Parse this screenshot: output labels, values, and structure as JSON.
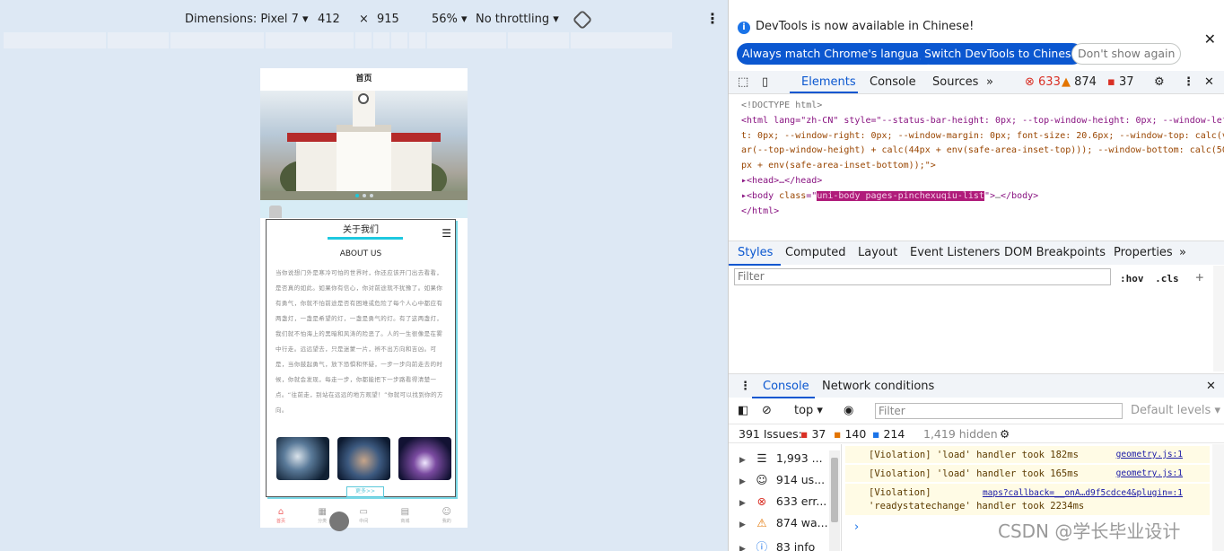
{
  "device_toolbar": {
    "dimensions": "Dimensions: Pixel 7 ▾",
    "width": "412",
    "times": "×",
    "height": "915",
    "zoom": "56% ▾",
    "throttling": "No throttling ▾"
  },
  "phone": {
    "title": "首页",
    "about_title": "关于我们",
    "about_sub": "ABOUT US",
    "about_text": "当你说想门外是寒冷可怕的世界时，你还应该开门出去看看，是否真的如此。如果你有信心，你对前途就不犹豫了。如果你有勇气，你就不怕前途是否有困难或危险了每个人心中都应有两盏灯，一盏是希望的灯，一盏是勇气的灯。有了这两盏灯，我们就不怕海上的黑暗和风涛的险恶了。人的一生很像是在雾中行走。远远望去，只是迷蒙一片，辨不出方向和吉凶。可是，当你鼓起勇气，放下恐惧和怀疑，一步一步向前走去的时候，你就会发现，每走一步，你都能把下一步路看得清楚一点。“往前走，别站在远远的地方观望！”你就可以找到你的方向。",
    "more_btn": "更多>>",
    "tabs": [
      "首页",
      "分类",
      "中间",
      "商城",
      "我的"
    ]
  },
  "devtools": {
    "banner_msg": "DevTools is now available in Chinese!",
    "btn_match": "Always match Chrome's language",
    "btn_switch": "Switch DevTools to Chinese",
    "btn_dont": "Don't show again",
    "tabs": {
      "elements": "Elements",
      "console": "Console",
      "sources": "Sources",
      "more": "»"
    },
    "counts": {
      "errors": "633",
      "warnings": "874",
      "issues": "37"
    },
    "dom": {
      "doctype": "<!DOCTYPE html>",
      "html_open_1": "<html lang=\"zh-CN\" style=\"--status-bar-height: 0px; --top-window-height: 0px; --window-lef",
      "html_open_2": "t: 0px; --window-right: 0px; --window-margin: 0px; font-size: 20.6px; --window-top: calc(v",
      "html_open_3": "ar(--top-window-height) + calc(44px + env(safe-area-inset-top))); --window-bottom: calc(50",
      "html_open_4": "px + env(safe-area-inset-bottom));\">",
      "head": "<head>…</head>",
      "body_class": "uni-body pages-pinchexuqiu-list",
      "html_close": "</html>"
    },
    "style_tabs": [
      "Styles",
      "Computed",
      "Layout",
      "Event Listeners",
      "DOM Breakpoints",
      "Properties",
      "»"
    ],
    "filter_placeholder": "Filter",
    "hov": ":hov",
    "cls": ".cls",
    "plus": "+",
    "console_tabs": [
      "Console",
      "Network conditions"
    ],
    "console_tools": {
      "context": "top ▾",
      "filter": "Filter",
      "levels": "Default levels ▾"
    },
    "issues_bar": {
      "label": "391 Issues:",
      "errors": "37",
      "warnings": "140",
      "infos": "214",
      "hidden": "1,419 hidden"
    },
    "sidebar": [
      {
        "icon": "list-icon",
        "label": "1,993 ..."
      },
      {
        "icon": "user-icon",
        "label": "914 us..."
      },
      {
        "icon": "error-icon",
        "label": "633 err..."
      },
      {
        "icon": "warning-icon",
        "label": "874 wa..."
      },
      {
        "icon": "info-icon",
        "label": "83 info"
      }
    ],
    "messages": [
      {
        "text": "[Violation] 'load' handler took 182ms",
        "src": "geometry.js:1"
      },
      {
        "text": "[Violation] 'load' handler took 165ms",
        "src": "geometry.js:1"
      },
      {
        "text": "[Violation]",
        "text2": "'readystatechange' handler took 2234ms",
        "link": "maps?callback=__onA…d9f5cdce4&plugin=:1"
      }
    ],
    "prompt": "›",
    "watermark": "CSDN @学长毕业设计"
  },
  "colors": {
    "accent": "#0b57d0",
    "teal": "#1ec8e0",
    "error": "#d93025",
    "warning": "#e37400"
  }
}
